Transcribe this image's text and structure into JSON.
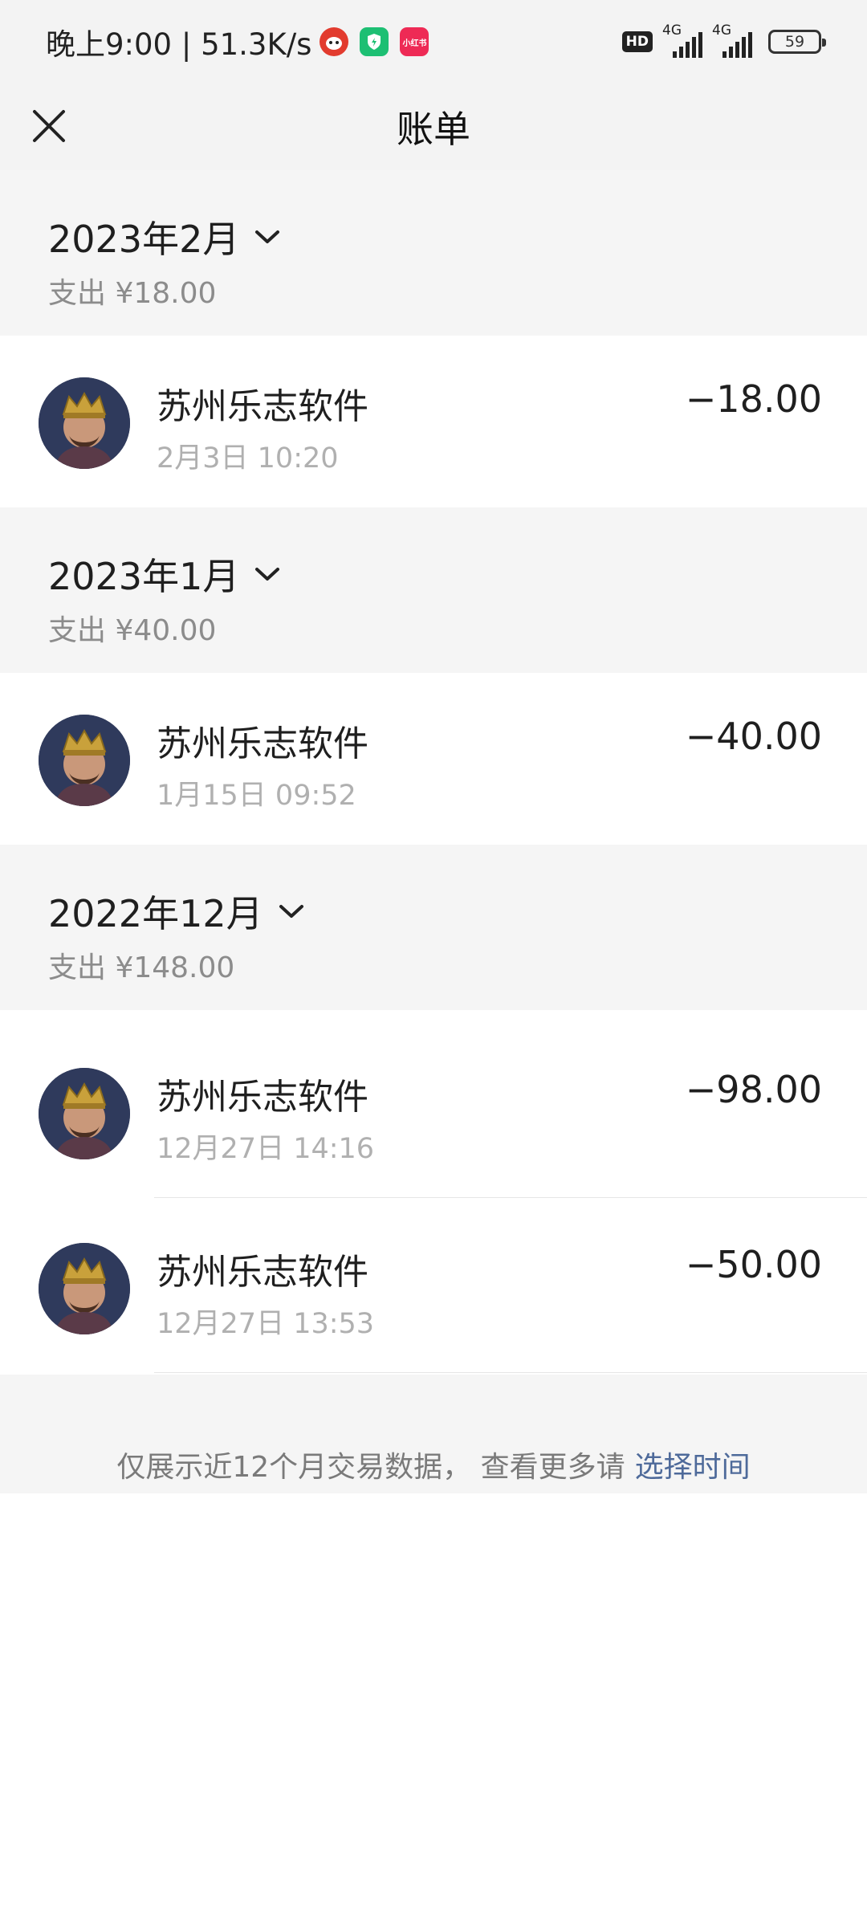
{
  "status_bar": {
    "time": "晚上9:00 | 51.3K/s",
    "hd": "HD",
    "network1": "4G",
    "network2": "4G",
    "battery": "59",
    "notif_red_label": "",
    "notif_pink_label": "小红书"
  },
  "header": {
    "title": "账单"
  },
  "months": [
    {
      "title": "2023年2月",
      "spend": "支出 ¥18.00",
      "transactions": [
        {
          "name": "苏州乐志软件",
          "time": "2月3日 10:20",
          "amount": "−18.00"
        }
      ]
    },
    {
      "title": "2023年1月",
      "spend": "支出 ¥40.00",
      "transactions": [
        {
          "name": "苏州乐志软件",
          "time": "1月15日 09:52",
          "amount": "−40.00"
        }
      ]
    },
    {
      "title": "2022年12月",
      "spend": "支出 ¥148.00",
      "transactions": [
        {
          "name": "苏州乐志软件",
          "time": "12月27日 14:16",
          "amount": "−98.00"
        },
        {
          "name": "苏州乐志软件",
          "time": "12月27日 13:53",
          "amount": "−50.00"
        }
      ]
    }
  ],
  "footer": {
    "text": "仅展示近12个月交易数据， 查看更多请",
    "link": "选择时间"
  },
  "colors": {
    "link": "#4e6a9a",
    "section_bg": "#f5f5f5"
  }
}
